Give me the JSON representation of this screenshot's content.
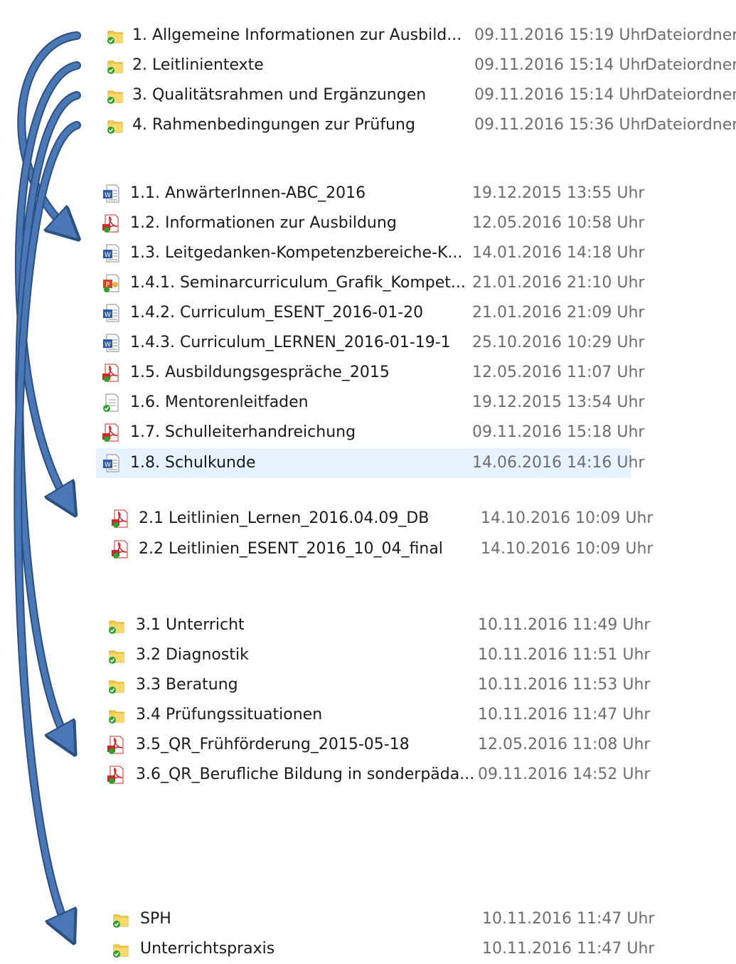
{
  "groups": [
    {
      "rows": [
        {
          "name": "1. Allgemeine Informationen zur Ausbild...",
          "date": "09.11.2016 15:19 Uhr",
          "type": "Dateiordner",
          "icon": "folder-synced-icon"
        },
        {
          "name": "2. Leitlinientexte",
          "date": "09.11.2016 15:14 Uhr",
          "type": "Dateiordner",
          "icon": "folder-synced-icon"
        },
        {
          "name": "3. Qualitätsrahmen und Ergänzungen",
          "date": "09.11.2016 15:14 Uhr",
          "type": "Dateiordner",
          "icon": "folder-synced-icon"
        },
        {
          "name": "4. Rahmenbedingungen zur Prüfung",
          "date": "09.11.2016 15:36 Uhr",
          "type": "Dateiordner",
          "icon": "folder-synced-icon"
        }
      ]
    },
    {
      "rows": [
        {
          "name": "1.1. AnwärterInnen-ABC_2016",
          "date": "19.12.2015 13:55 Uhr",
          "icon": "word-document-icon"
        },
        {
          "name": "1.2. Informationen zur Ausbildung",
          "date": "12.05.2016 10:58 Uhr",
          "icon": "pdf-document-icon"
        },
        {
          "name": "1.3. Leitgedanken-Kompetenzbereiche-K...",
          "date": "14.01.2016 14:18 Uhr",
          "icon": "word-document-icon"
        },
        {
          "name": "1.4.1. Seminarcurriculum_Grafik_Kompet...",
          "date": "21.01.2016 21:10 Uhr",
          "icon": "powerpoint-document-icon"
        },
        {
          "name": "1.4.2. Curriculum_ESENT_2016-01-20",
          "date": "21.01.2016 21:09 Uhr",
          "icon": "word-document-icon"
        },
        {
          "name": "1.4.3. Curriculum_LERNEN_2016-01-19-1",
          "date": "25.10.2016 10:29 Uhr",
          "icon": "word-document-icon"
        },
        {
          "name": "1.5. Ausbildungsgespräche_2015",
          "date": "12.05.2016 11:07 Uhr",
          "icon": "pdf-document-icon"
        },
        {
          "name": "1.6. Mentorenleitfaden",
          "date": "19.12.2015 13:54 Uhr",
          "icon": "generic-document-icon"
        },
        {
          "name": "1.7. Schulleiterhandreichung",
          "date": "09.11.2016 15:18 Uhr",
          "icon": "pdf-document-icon"
        },
        {
          "name": "1.8. Schulkunde",
          "date": "14.06.2016 14:16 Uhr",
          "icon": "word-document-icon",
          "selected": true
        }
      ]
    },
    {
      "rows": [
        {
          "name": "2.1 Leitlinien_Lernen_2016.04.09_DB",
          "date": "14.10.2016 10:09 Uhr",
          "icon": "pdf-document-icon"
        },
        {
          "name": "2.2 Leitlinien_ESENT_2016_10_04_final",
          "date": "14.10.2016 10:09 Uhr",
          "icon": "pdf-document-icon"
        }
      ]
    },
    {
      "rows": [
        {
          "name": "3.1 Unterricht",
          "date": "10.11.2016 11:49 Uhr",
          "icon": "folder-synced-icon"
        },
        {
          "name": "3.2 Diagnostik",
          "date": "10.11.2016 11:51 Uhr",
          "icon": "folder-synced-icon"
        },
        {
          "name": "3.3 Beratung",
          "date": "10.11.2016 11:53 Uhr",
          "icon": "folder-synced-icon"
        },
        {
          "name": "3.4 Prüfungssituationen",
          "date": "10.11.2016 11:47 Uhr",
          "icon": "folder-synced-icon"
        },
        {
          "name": "3.5_QR_Frühförderung_2015-05-18",
          "date": "12.05.2016 11:08 Uhr",
          "icon": "pdf-document-icon"
        },
        {
          "name": "3.6_QR_Berufliche Bildung in sonderpäda...",
          "date": "09.11.2016 14:52 Uhr",
          "icon": "pdf-document-icon"
        }
      ]
    },
    {
      "rows": [
        {
          "name": "SPH",
          "date": "10.11.2016 11:47 Uhr",
          "icon": "folder-synced-icon"
        },
        {
          "name": "Unterrichtspraxis",
          "date": "10.11.2016 11:47 Uhr",
          "icon": "folder-synced-icon"
        }
      ]
    }
  ],
  "colors": {
    "arrow_fill": "#4a77b6",
    "arrow_stroke": "#2c4f80",
    "selection": "#e5f3ff",
    "date_text": "#6d6d6d",
    "folder_yellow": "#f5c94a",
    "sync_green": "#2ea02e",
    "pdf_red": "#cc2a2a",
    "word_blue": "#2b5ca8"
  }
}
